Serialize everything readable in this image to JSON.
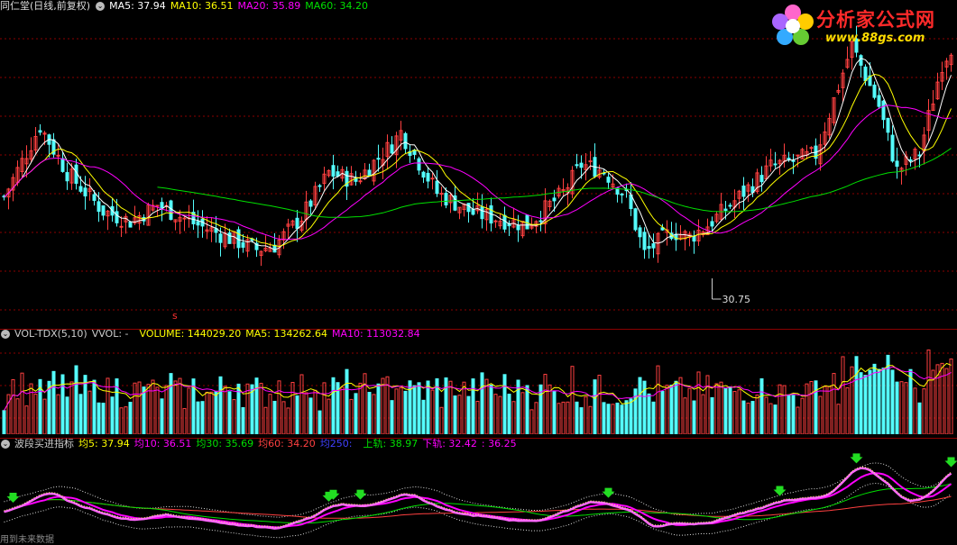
{
  "header": {
    "title": "同仁堂(日线,前复权)",
    "ma5": "MA5: 37.94",
    "ma10": "MA10: 36.51",
    "ma20": "MA20: 35.89",
    "ma60": "MA60: 34.20"
  },
  "volume_header": {
    "name": "VOL-TDX(5,10)",
    "vvol": "VVOL: -",
    "volume": "VOLUME: 144029.20",
    "ma5": "MA5: 134262.64",
    "ma10": "MA10: 113032.84"
  },
  "indicator_header": {
    "name": "波段买进指标",
    "j5": "均5: 37.94",
    "j10": "均10: 36.51",
    "j30": "均30: 35.69",
    "j60": "均60: 34.20",
    "j250": "均250:",
    "upper": "上轨: 38.97",
    "lower": "下轨: 32.42",
    "extra": ": 36.25"
  },
  "logo": {
    "title": "分析家公式网",
    "url": "www.88gs.com"
  },
  "footer_text": "用到未来数据",
  "colors": {
    "up": "#ff4040",
    "down": "#54fcfc",
    "ma5": "#ffffff",
    "ma10": "#ffff00",
    "ma20": "#ff00ff",
    "ma60": "#00e000",
    "grid": "#8b0000",
    "marker": "#22dd22"
  },
  "chart_data": [
    {
      "type": "candlestick",
      "annotations": [
        {
          "label": "30.75"
        }
      ],
      "marker_label": "s",
      "series": [
        {
          "name": "MA5",
          "value": 37.94
        },
        {
          "name": "MA10",
          "value": 36.51
        },
        {
          "name": "MA20",
          "value": 35.89
        },
        {
          "name": "MA60",
          "value": 34.2
        }
      ]
    },
    {
      "type": "bar",
      "series": [
        {
          "name": "VOLUME",
          "value": 144029.2
        },
        {
          "name": "MA5",
          "value": 134262.64
        },
        {
          "name": "MA10",
          "value": 113032.84
        }
      ]
    },
    {
      "type": "line",
      "buy_signal_count": 8,
      "series": [
        {
          "name": "均5",
          "value": 37.94
        },
        {
          "name": "均10",
          "value": 36.51
        },
        {
          "name": "均30",
          "value": 35.69
        },
        {
          "name": "均60",
          "value": 34.2
        },
        {
          "name": "上轨",
          "value": 38.97
        },
        {
          "name": "下轨",
          "value": 32.42
        }
      ]
    }
  ]
}
